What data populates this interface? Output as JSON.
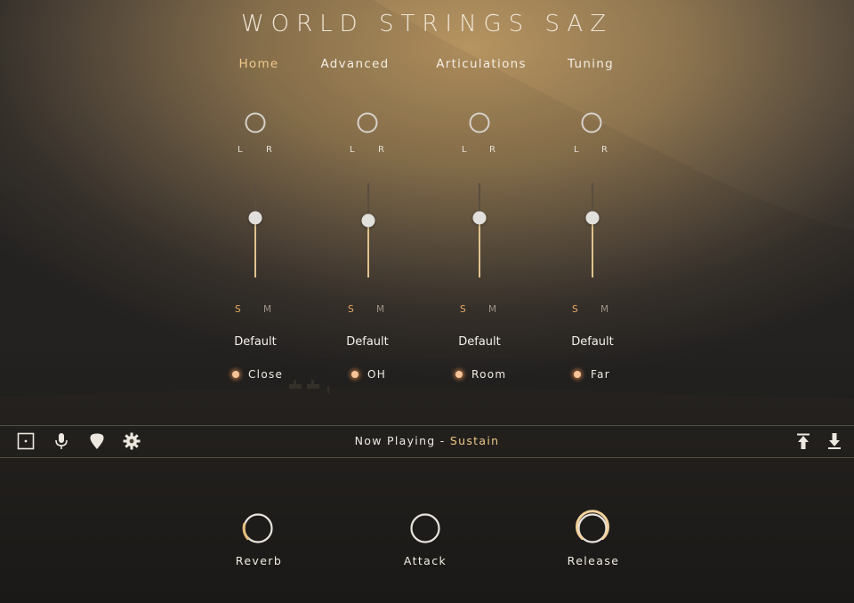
{
  "app": {
    "title": "WORLD STRINGS SAZ"
  },
  "tabs": [
    {
      "label": "Home",
      "active": true
    },
    {
      "label": "Advanced",
      "active": false
    },
    {
      "label": "Articulations",
      "active": false
    },
    {
      "label": "Tuning",
      "active": false
    }
  ],
  "channels": [
    {
      "pan_left": "L",
      "pan_right": "R",
      "fader_level": 0.62,
      "solo": "S",
      "mute": "M",
      "preset": "Default",
      "mic": "Close"
    },
    {
      "pan_left": "L",
      "pan_right": "R",
      "fader_level": 0.6,
      "solo": "S",
      "mute": "M",
      "preset": "Default",
      "mic": "OH"
    },
    {
      "pan_left": "L",
      "pan_right": "R",
      "fader_level": 0.62,
      "solo": "S",
      "mute": "M",
      "preset": "Default",
      "mic": "Room"
    },
    {
      "pan_left": "L",
      "pan_right": "R",
      "fader_level": 0.62,
      "solo": "S",
      "mute": "M",
      "preset": "Default",
      "mic": "Far"
    }
  ],
  "toolbar": {
    "left_icons": [
      "square-dot-icon",
      "microphone-icon",
      "pick-icon",
      "gear-icon"
    ],
    "now_playing_label": "Now Playing -",
    "now_playing_value": "Sustain",
    "right_icons": [
      "upload-icon",
      "download-icon"
    ]
  },
  "knobs": [
    {
      "label": "Reverb",
      "value": 0.15
    },
    {
      "label": "Attack",
      "value": 0.0
    },
    {
      "label": "Release",
      "value": 0.92
    }
  ],
  "colors": {
    "accent": "#f1c98a",
    "solo": "#e5ac64",
    "mic_dot": "#f6c597"
  }
}
